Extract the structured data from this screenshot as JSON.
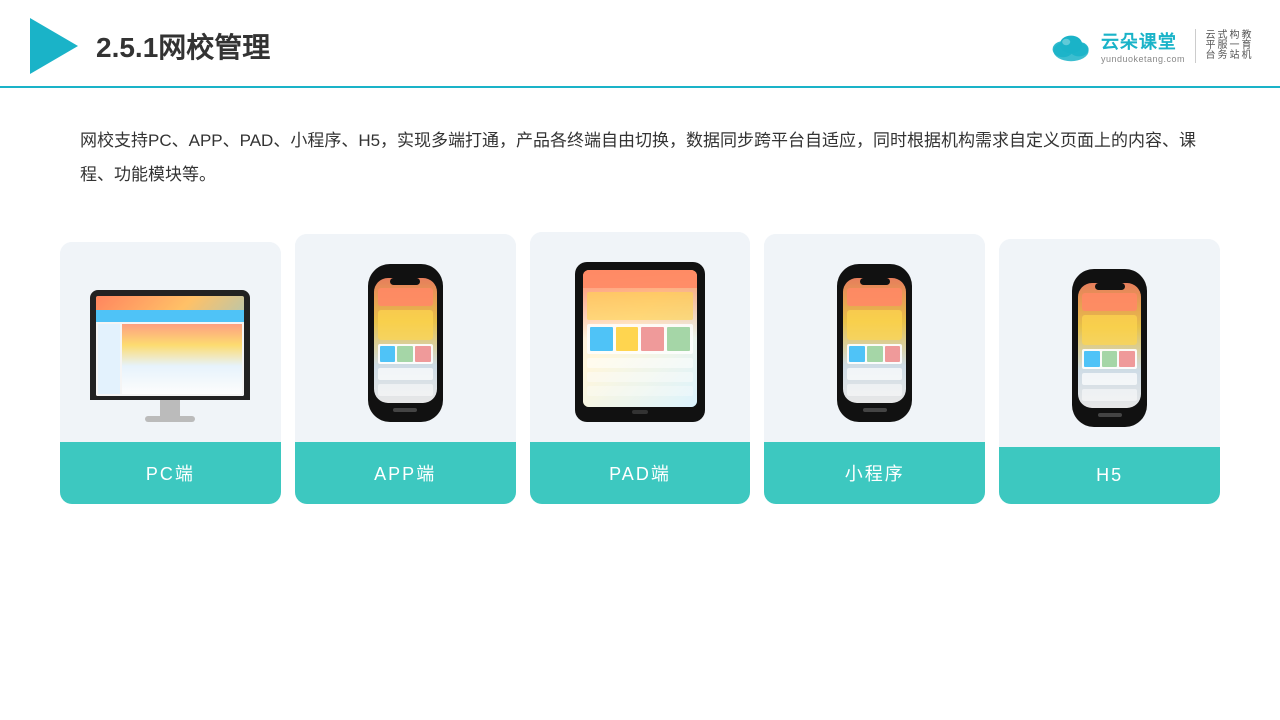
{
  "header": {
    "title": "2.5.1网校管理",
    "brand": {
      "name": "云朵课堂",
      "url": "yunduoketang.com",
      "tagline": "教育机构一站式服务云平台"
    }
  },
  "description": {
    "text": "网校支持PC、APP、PAD、小程序、H5，实现多端打通，产品各终端自由切换，数据同步跨平台自适应，同时根据机构需求自定义页面上的内容、课程、功能模块等。"
  },
  "cards": [
    {
      "id": "pc",
      "label": "PC端"
    },
    {
      "id": "app",
      "label": "APP端"
    },
    {
      "id": "pad",
      "label": "PAD端"
    },
    {
      "id": "miniprogram",
      "label": "小程序"
    },
    {
      "id": "h5",
      "label": "H5"
    }
  ],
  "colors": {
    "accent": "#1ab3c8",
    "card_bg": "#eef2f7",
    "card_label_bg": "#3dc8c0",
    "card_label_text": "#ffffff"
  }
}
